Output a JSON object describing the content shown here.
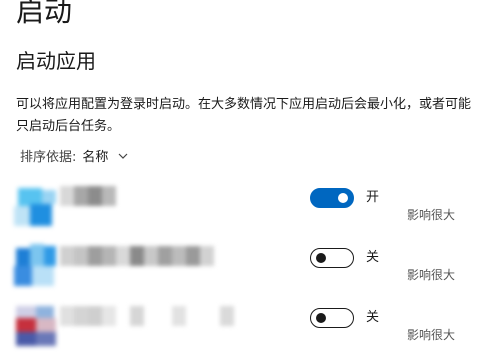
{
  "page": {
    "title": "启动",
    "section_title": "启动应用",
    "description": "可以将应用配置为登录时启动。在大多数情况下应用启动后会最小化，或者可能只启动后台任务。"
  },
  "sort": {
    "label": "排序依据:",
    "value": "名称",
    "icon": "chevron-down-icon"
  },
  "apps": [
    {
      "toggle_on": true,
      "state_label": "开",
      "impact": "影响很大"
    },
    {
      "toggle_on": false,
      "state_label": "关",
      "impact": "影响很大"
    },
    {
      "toggle_on": false,
      "state_label": "关",
      "impact": "影响很大"
    }
  ],
  "colors": {
    "accent": "#0067c0",
    "text": "#1a1a1a",
    "secondary_text": "#555555",
    "background": "#ffffff"
  }
}
